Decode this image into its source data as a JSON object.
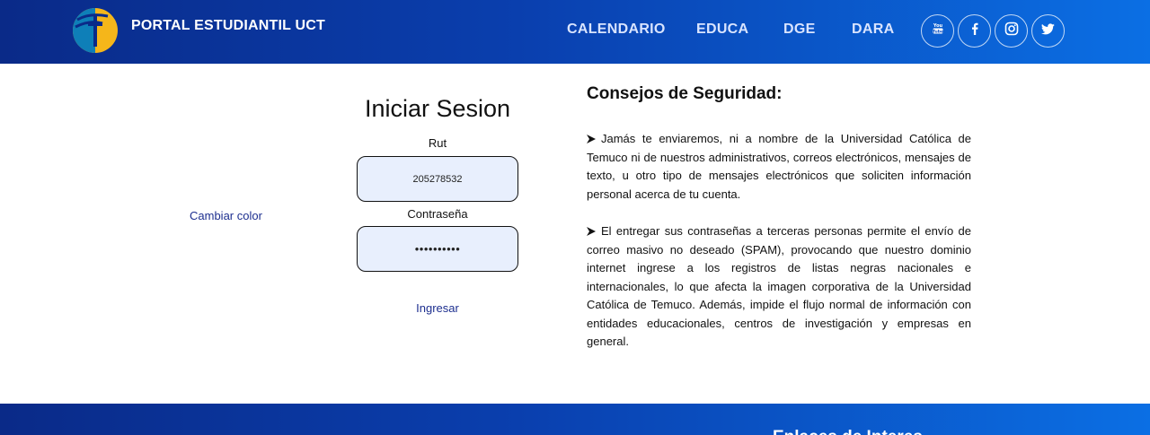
{
  "header": {
    "brand": "PORTAL ESTUDIANTIL UCT",
    "nav": [
      "CALENDARIO",
      "EDUCA",
      "DGE",
      "DARA"
    ],
    "social": [
      "youtube-icon",
      "facebook-icon",
      "instagram-icon",
      "twitter-icon"
    ]
  },
  "login": {
    "cambiar_color": "Cambiar color",
    "title": "Iniciar Sesion",
    "rut_label": "Rut",
    "rut_value": "205278532",
    "password_label": "Contraseña",
    "password_value": "••••••••••",
    "submit": "Ingresar"
  },
  "consejos": {
    "title": "Consejos de Seguridad:",
    "tips": [
      "Jamás te enviaremos, ni a nombre de la Universidad Católica de Temuco ni de nuestros administrativos, correos electrónicos, mensajes de texto, u otro tipo de mensajes electrónicos que soliciten información personal acerca de tu cuenta.",
      "El entregar sus contraseñas a terceras personas permite el envío de correo masivo no deseado (SPAM), provocando que nuestro dominio internet ingrese a los registros de listas negras nacionales e internacionales, lo que afecta la imagen corporativa de la Universidad Católica de Temuco. Además, impide el flujo normal de información con entidades educacionales, centros de investigación y empresas en general."
    ]
  },
  "footer": {
    "title": "Enlaces de Interes"
  },
  "colors": {
    "header_start": "#0a2a88",
    "header_end": "#0b6fe4",
    "link": "#1d2f8f",
    "field_bg": "#e8effd",
    "logo_yellow": "#f5b61a"
  }
}
